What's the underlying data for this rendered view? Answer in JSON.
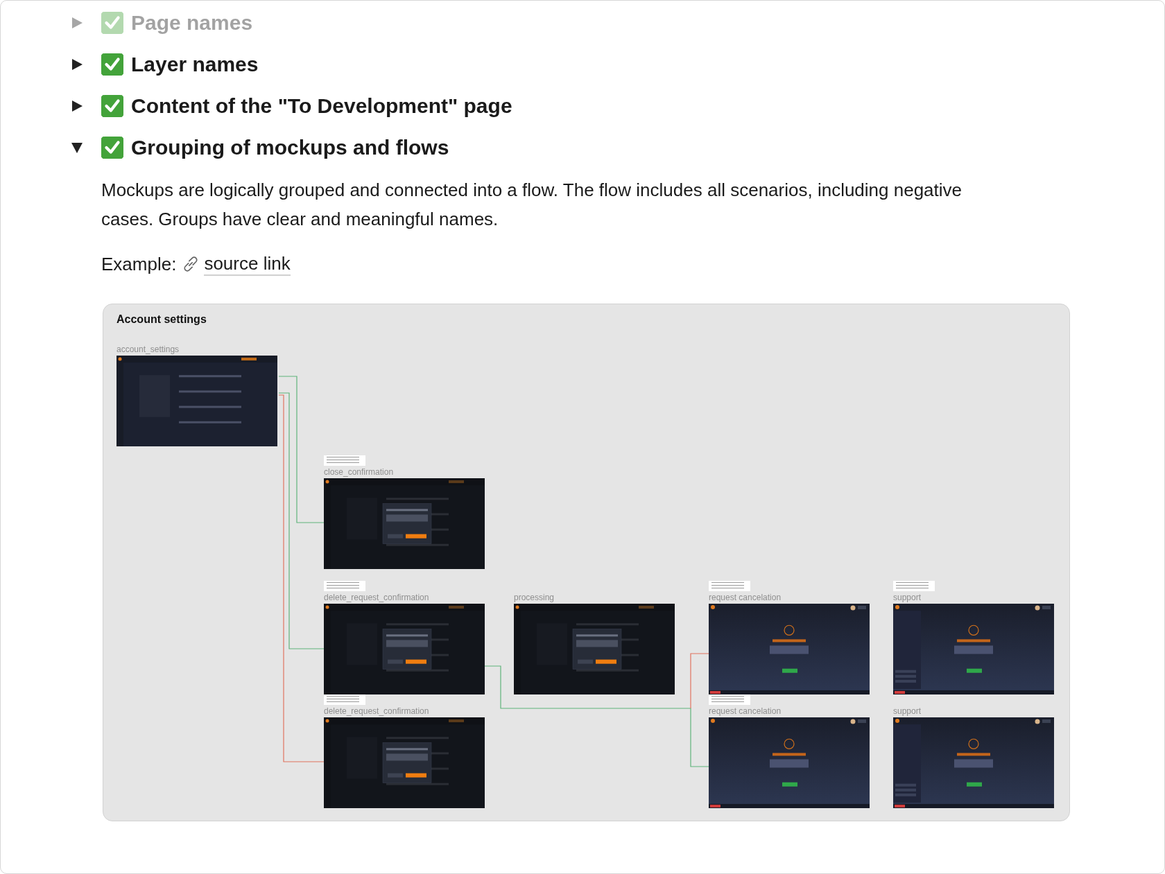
{
  "toggles": [
    {
      "title": "Page names",
      "expanded": false,
      "checked": true,
      "dimmed": true
    },
    {
      "title": "Layer names",
      "expanded": false,
      "checked": true,
      "dimmed": false
    },
    {
      "title": "Content of the \"To Development\" page",
      "expanded": false,
      "checked": true,
      "dimmed": false
    },
    {
      "title": "Grouping of mockups and flows",
      "expanded": true,
      "checked": true,
      "dimmed": false,
      "body": {
        "paragraph": "Mockups are logically grouped and connected into a flow. The flow includes all scenarios, including negative cases. Groups have clear and meaningful names.",
        "example_label": "Example:",
        "link": "source link"
      }
    }
  ],
  "embed": {
    "title": "Account settings",
    "frames": [
      {
        "label": "account_settings",
        "kind": "settings",
        "note": false
      },
      {
        "label": "close_confirmation",
        "kind": "dialog",
        "note": true
      },
      {
        "label": "delete_request_confirmation",
        "kind": "dialog",
        "note": true
      },
      {
        "label": "processing",
        "kind": "dialog",
        "note": false
      },
      {
        "label": "request cancelation",
        "kind": "notice",
        "note": true
      },
      {
        "label": "support",
        "kind": "notice-sidebar",
        "note": true
      },
      {
        "label": "delete_request_confirmation",
        "kind": "dialog",
        "note": true
      },
      {
        "label": "request cancelation",
        "kind": "notice",
        "note": true
      },
      {
        "label": "support",
        "kind": "notice-sidebar",
        "note": false
      }
    ]
  }
}
